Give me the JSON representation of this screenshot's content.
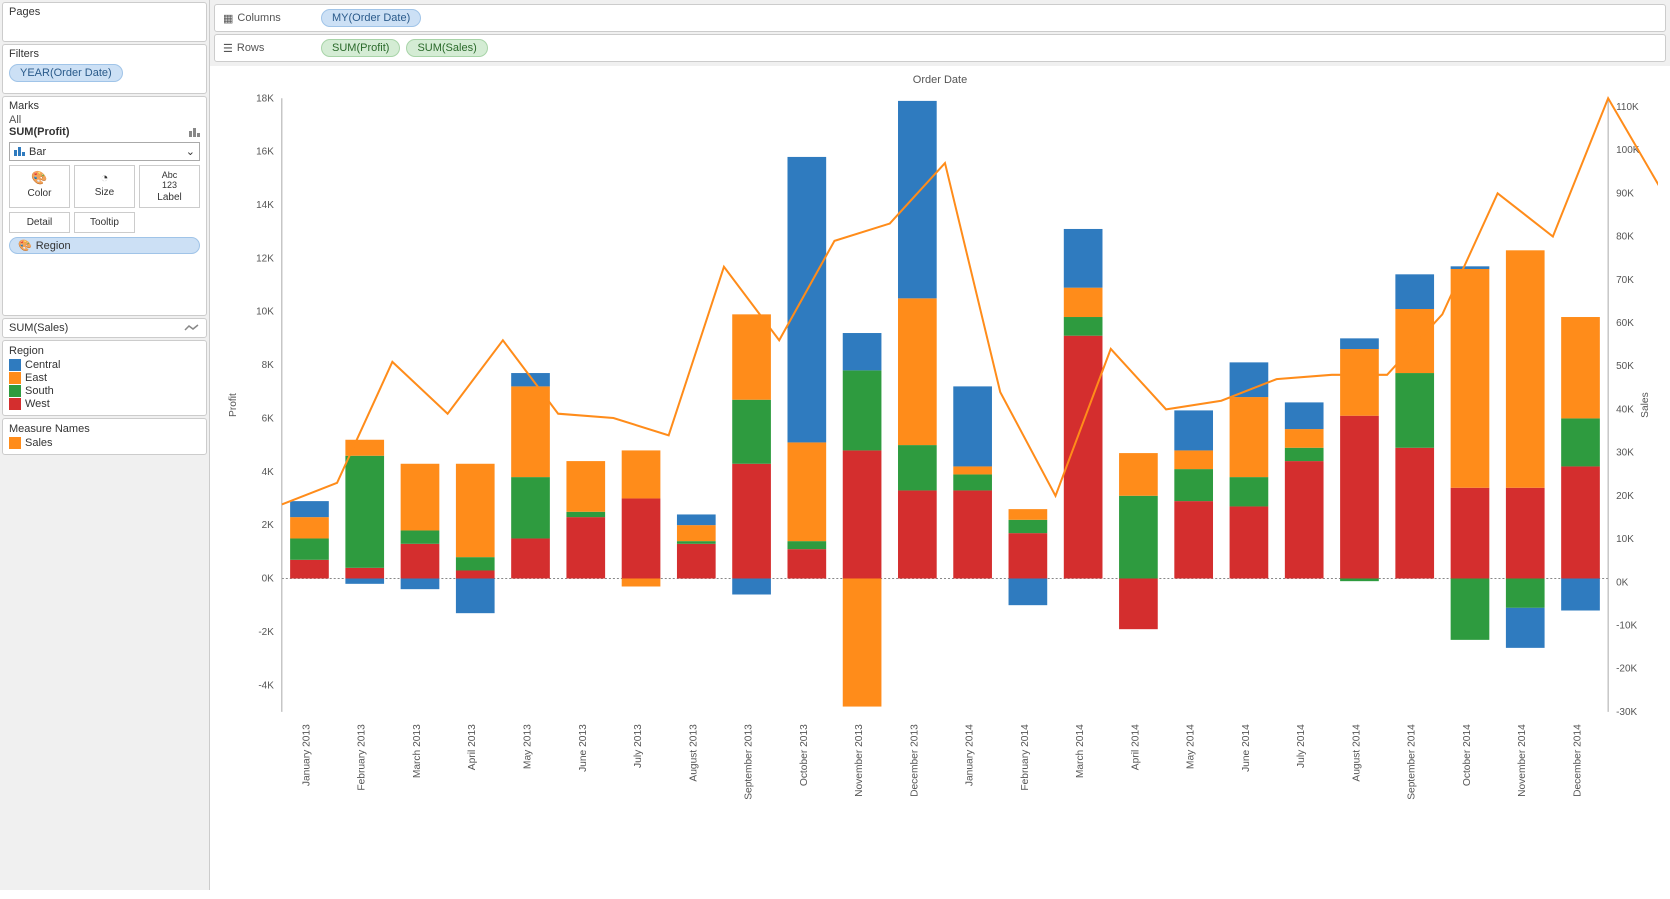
{
  "sidebar": {
    "pages_title": "Pages",
    "filters_title": "Filters",
    "filter_pill": "YEAR(Order Date)",
    "marks_title": "Marks",
    "marks_all": "All",
    "marks_profit": "SUM(Profit)",
    "mark_type": "Bar",
    "mark_cells": {
      "color": "Color",
      "size": "Size",
      "label": "Label",
      "detail": "Detail",
      "tooltip": "Tooltip"
    },
    "region_pill": "Region",
    "marks_sales": "SUM(Sales)",
    "region_legend": {
      "title": "Region",
      "items": [
        {
          "label": "Central",
          "color": "#2f7bbf"
        },
        {
          "label": "East",
          "color": "#ff8c1a"
        },
        {
          "label": "South",
          "color": "#2e9b3f"
        },
        {
          "label": "West",
          "color": "#d42e2e"
        }
      ]
    },
    "measure_legend": {
      "title": "Measure Names",
      "items": [
        {
          "label": "Sales",
          "color": "#ff8c1a"
        }
      ]
    }
  },
  "shelves": {
    "columns_label": "Columns",
    "columns_pill": "MY(Order Date)",
    "rows_label": "Rows",
    "rows_pills": [
      "SUM(Profit)",
      "SUM(Sales)"
    ]
  },
  "chart_title": "Order Date",
  "axis_labels": {
    "left": "Profit",
    "right": "Sales"
  },
  "chart_data": {
    "type": "bar",
    "categories": [
      "January 2013",
      "February 2013",
      "March 2013",
      "April 2013",
      "May 2013",
      "June 2013",
      "July 2013",
      "August 2013",
      "September 2013",
      "October 2013",
      "November 2013",
      "December 2013",
      "January 2014",
      "February 2014",
      "March 2014",
      "April 2014",
      "May 2014",
      "June 2014",
      "July 2014",
      "August 2014",
      "September 2014",
      "October 2014",
      "November 2014",
      "December 2014"
    ],
    "profit_ylim": [
      -5000,
      18000
    ],
    "profit_ticks": [
      -4000,
      -2000,
      0,
      2000,
      4000,
      6000,
      8000,
      10000,
      12000,
      14000,
      16000,
      18000
    ],
    "profit_tick_labels": [
      "-4K",
      "-2K",
      "0K",
      "2K",
      "4K",
      "6K",
      "8K",
      "10K",
      "12K",
      "14K",
      "16K",
      "18K"
    ],
    "sales_ylim": [
      -30000,
      112000
    ],
    "sales_ticks": [
      -30000,
      -20000,
      -10000,
      0,
      10000,
      20000,
      30000,
      40000,
      50000,
      60000,
      70000,
      80000,
      90000,
      100000,
      110000
    ],
    "sales_tick_labels": [
      "-30K",
      "-20K",
      "-10K",
      "0K",
      "10K",
      "20K",
      "30K",
      "40K",
      "50K",
      "60K",
      "70K",
      "80K",
      "90K",
      "100K",
      "110K"
    ],
    "bar_series": [
      {
        "name": "West",
        "color": "#d42e2e",
        "values": {
          "pos": [
            700,
            400,
            1300,
            300,
            1500,
            2300,
            3000,
            1300,
            4300,
            1100,
            4800,
            3300,
            3300,
            1700,
            9100,
            0,
            2900,
            2700,
            4400,
            6100,
            4900,
            3400,
            3400,
            4200
          ],
          "neg": [
            0,
            0,
            0,
            0,
            0,
            0,
            0,
            0,
            0,
            0,
            0,
            0,
            0,
            0,
            0,
            -1900,
            0,
            0,
            0,
            0,
            0,
            0,
            0,
            0
          ]
        }
      },
      {
        "name": "South",
        "color": "#2e9b3f",
        "values": {
          "pos": [
            800,
            4200,
            500,
            500,
            2300,
            200,
            0,
            100,
            2400,
            300,
            3000,
            1700,
            600,
            500,
            700,
            3100,
            1200,
            1100,
            500,
            0,
            2800,
            0,
            0,
            1800
          ],
          "neg": [
            0,
            0,
            0,
            0,
            0,
            0,
            0,
            0,
            0,
            0,
            0,
            0,
            0,
            0,
            0,
            0,
            0,
            0,
            0,
            -100,
            0,
            -2300,
            -1100,
            0
          ]
        }
      },
      {
        "name": "East",
        "color": "#ff8c1a",
        "values": {
          "pos": [
            800,
            600,
            2500,
            3500,
            3400,
            1900,
            1800,
            600,
            3200,
            3700,
            0,
            5500,
            300,
            400,
            1100,
            1600,
            700,
            3000,
            700,
            2500,
            2400,
            8200,
            8900,
            3800
          ],
          "neg": [
            0,
            0,
            0,
            0,
            0,
            0,
            -300,
            0,
            0,
            0,
            -4800,
            0,
            0,
            0,
            0,
            0,
            0,
            0,
            0,
            0,
            0,
            0,
            0,
            0
          ]
        }
      },
      {
        "name": "Central",
        "color": "#2f7bbf",
        "values": {
          "pos": [
            600,
            0,
            0,
            0,
            500,
            0,
            0,
            400,
            0,
            10700,
            1400,
            7400,
            3000,
            0,
            2200,
            0,
            1500,
            1300,
            1000,
            400,
            1300,
            100,
            0,
            0
          ],
          "neg": [
            0,
            -200,
            -400,
            -1300,
            0,
            0,
            0,
            0,
            -600,
            0,
            0,
            0,
            0,
            -1000,
            0,
            0,
            0,
            0,
            0,
            0,
            0,
            0,
            -1500,
            -1200
          ]
        }
      }
    ],
    "sales_line": [
      18000,
      23000,
      51000,
      39000,
      56000,
      39000,
      38000,
      34000,
      73000,
      56000,
      79000,
      83000,
      97000,
      44000,
      20000,
      54000,
      40000,
      42000,
      47000,
      48000,
      48000,
      62000,
      90000,
      80000,
      112000,
      90000
    ],
    "sales_line_x_offset": -0.5
  }
}
